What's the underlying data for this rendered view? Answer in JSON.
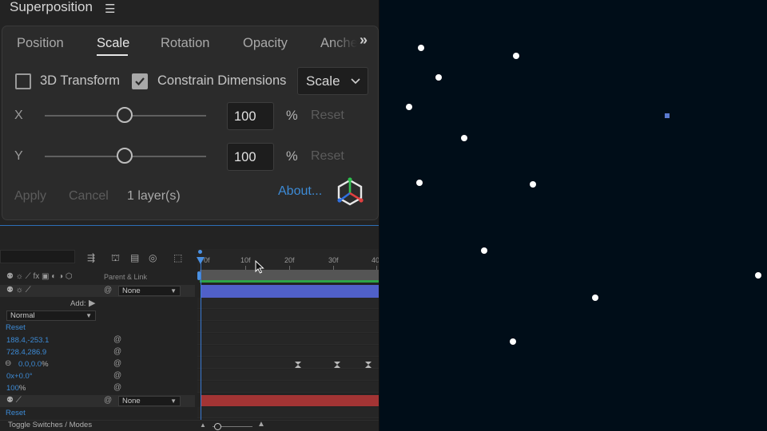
{
  "panel": {
    "title": "Superposition",
    "tabs": [
      {
        "label": "Position"
      },
      {
        "label": "Scale"
      },
      {
        "label": "Rotation"
      },
      {
        "label": "Opacity"
      },
      {
        "label": "Anche"
      }
    ],
    "active_tab": "Scale",
    "transform_3d": {
      "label": "3D Transform",
      "checked": false
    },
    "constrain": {
      "label": "Constrain Dimensions",
      "checked": true
    },
    "mode_select": {
      "value": "Scale"
    },
    "x": {
      "axis": "X",
      "value": "100",
      "unit": "%",
      "reset": "Reset",
      "slider_level": 0.5
    },
    "y": {
      "axis": "Y",
      "value": "100",
      "unit": "%",
      "reset": "Reset",
      "slider_level": 0.5
    },
    "apply": "Apply",
    "cancel": "Cancel",
    "layers": "1 layer(s)",
    "about": "About..."
  },
  "timeline": {
    "ruler": [
      "0f",
      "10f",
      "20f",
      "30f",
      "40"
    ],
    "parent_link": "Parent & Link",
    "layer1_parent": "None",
    "add_label": "Add:",
    "mode": "Normal",
    "reset1": "Reset",
    "props": [
      {
        "value": "188.4,-253.1"
      },
      {
        "value": "728.4,286.9"
      },
      {
        "value": "0.0,0.0",
        "unit": "%"
      },
      {
        "value": "0x+0.0°"
      },
      {
        "value": "100",
        "unit": "%"
      }
    ],
    "layer2_parent": "None",
    "reset2": "Reset",
    "toggle": "Toggle Switches / Modes"
  },
  "colors": {
    "accent_blue": "#3d8bd6",
    "layer1": "#5060c8",
    "layer2": "#a33434",
    "preview_bg": "#000d18"
  }
}
